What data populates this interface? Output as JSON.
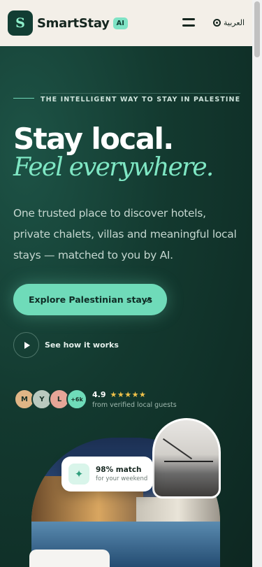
{
  "header": {
    "logo_letter": "S",
    "brand": "SmartStay",
    "badge": "AI",
    "language": "العربية"
  },
  "hero": {
    "eyebrow": "THE INTELLIGENT WAY TO STAY IN PALESTINE",
    "headline": "Stay local.",
    "headline_accent": "Feel everywhere.",
    "description": "One trusted place to discover hotels, private chalets, villas and meaningful local stays — matched to you by AI.",
    "cta_label": "Explore Palestinian stays",
    "cta_arrow": "↗",
    "how_label": "See how it works"
  },
  "social_proof": {
    "avatars": [
      {
        "initial": "M",
        "color": "#e0b686"
      },
      {
        "initial": "Y",
        "color": "#b9c9bf"
      },
      {
        "initial": "L",
        "color": "#e6a597"
      },
      {
        "initial": "+6k",
        "color": "#6fdbb9"
      }
    ],
    "rating": "4.9",
    "stars": "★★★★★",
    "caption": "from verified local guests"
  },
  "match_card": {
    "icon": "sparkle-icon",
    "title": "98% match",
    "subtitle": "for your weekend"
  },
  "colors": {
    "accent": "#6fdbb9",
    "brand_dark": "#123d33",
    "header_bg": "#f3efe8"
  }
}
